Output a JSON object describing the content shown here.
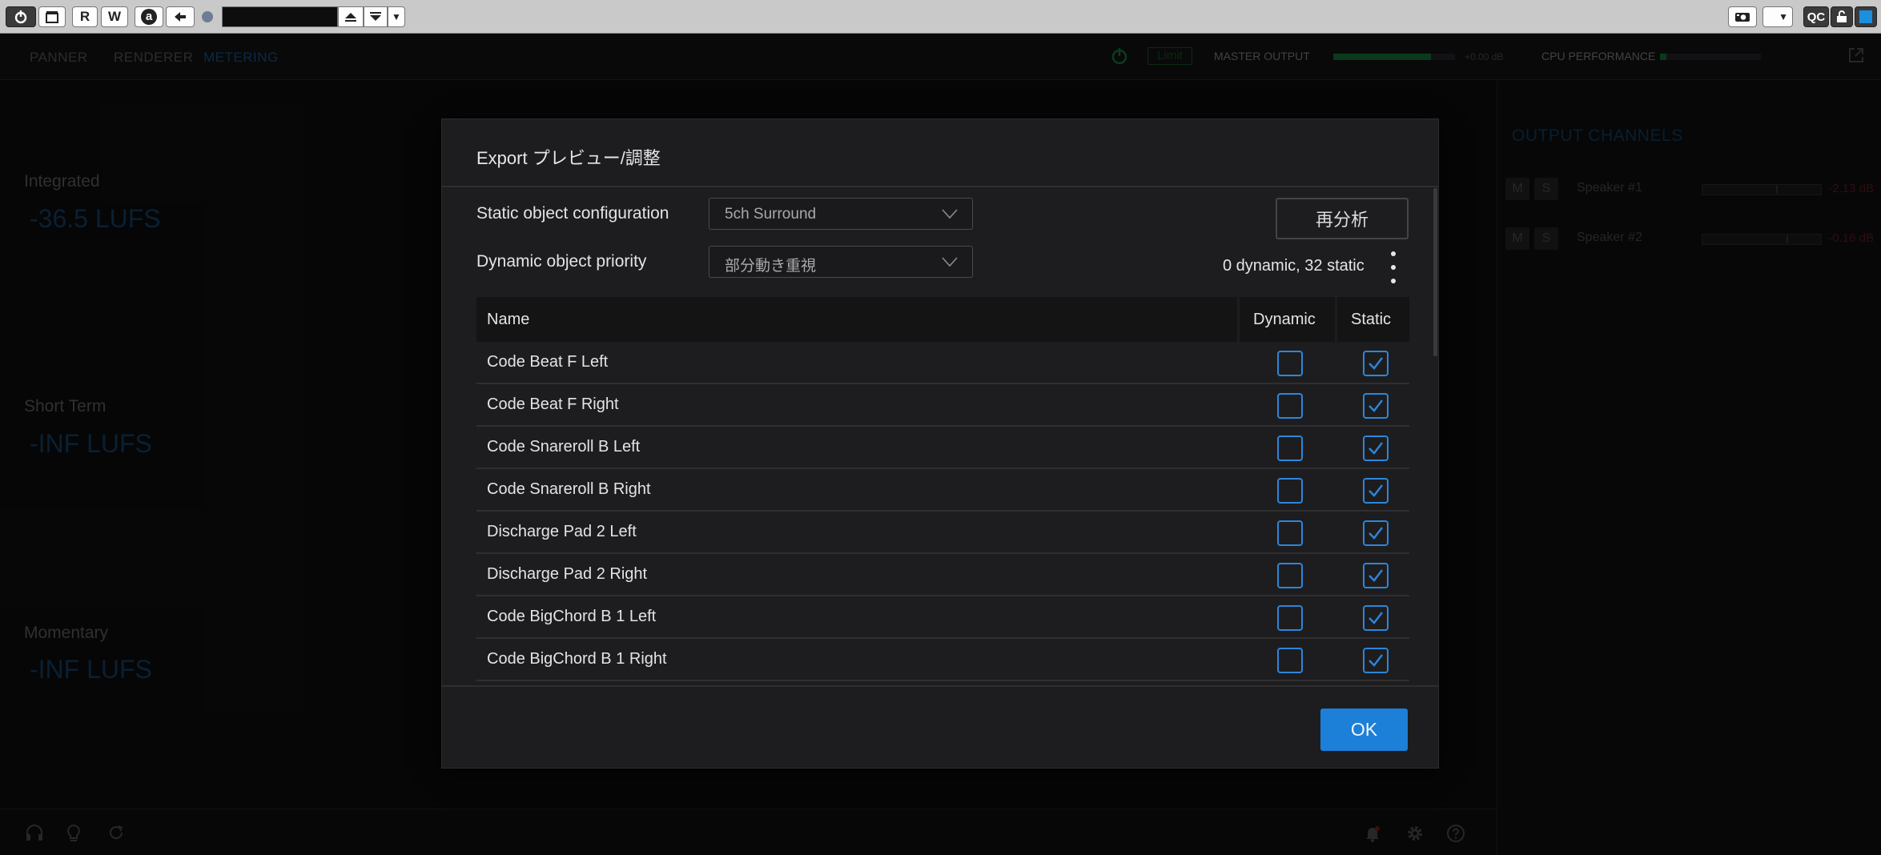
{
  "toolbar": {
    "r_label": "R",
    "w_label": "W",
    "a_label": "a",
    "qc_label": "QC",
    "dropdown_arrow": "▼"
  },
  "nav": {
    "tabs": [
      {
        "label": "PANNER"
      },
      {
        "label": "RENDERER"
      },
      {
        "label": "METERING"
      }
    ],
    "limit_label": "Limit",
    "master_output_label": "MASTER OUTPUT",
    "master_output_level": 0.8,
    "master_db": "+0.00 dB",
    "cpu_label": "CPU PERFORMANCE",
    "cpu_level": 0.06
  },
  "loudness": {
    "integrated_label": "Integrated",
    "integrated_value": "-36.5 LUFS",
    "short_term_label": "Short Term",
    "short_term_value": "-INF LUFS",
    "momentary_label": "Momentary",
    "momentary_value": "-INF LUFS"
  },
  "output_channels": {
    "title": "OUTPUT CHANNELS",
    "mute_label": "M",
    "solo_label": "S",
    "speakers": [
      {
        "name": "Speaker #1",
        "db": "-2.13 dB"
      },
      {
        "name": "Speaker #2",
        "db": "-0.16 dB"
      }
    ]
  },
  "dialog": {
    "title": "Export プレビュー/調整",
    "static_config_label": "Static object configuration",
    "static_config_value": "5ch Surround",
    "dynamic_priority_label": "Dynamic object priority",
    "dynamic_priority_value": "部分動き重視",
    "reanalyze_label": "再分析",
    "count_summary": "0 dynamic, 32 static",
    "columns": {
      "name": "Name",
      "dynamic": "Dynamic",
      "static": "Static"
    },
    "rows": [
      {
        "name": "Code Beat F Left",
        "dynamic": false,
        "static": true
      },
      {
        "name": "Code Beat F Right",
        "dynamic": false,
        "static": true
      },
      {
        "name": "Code Snareroll B Left",
        "dynamic": false,
        "static": true
      },
      {
        "name": "Code Snareroll B Right",
        "dynamic": false,
        "static": true
      },
      {
        "name": "Discharge Pad 2 Left",
        "dynamic": false,
        "static": true
      },
      {
        "name": "Discharge Pad 2 Right",
        "dynamic": false,
        "static": true
      },
      {
        "name": "Code BigChord B 1 Left",
        "dynamic": false,
        "static": true
      },
      {
        "name": "Code BigChord B 1 Right",
        "dynamic": false,
        "static": true
      }
    ],
    "ok_label": "OK"
  },
  "colors": {
    "accent": "#1c7fd8",
    "checkbox_border": "#2d86da",
    "dialog_bg": "#1d1d1f"
  }
}
